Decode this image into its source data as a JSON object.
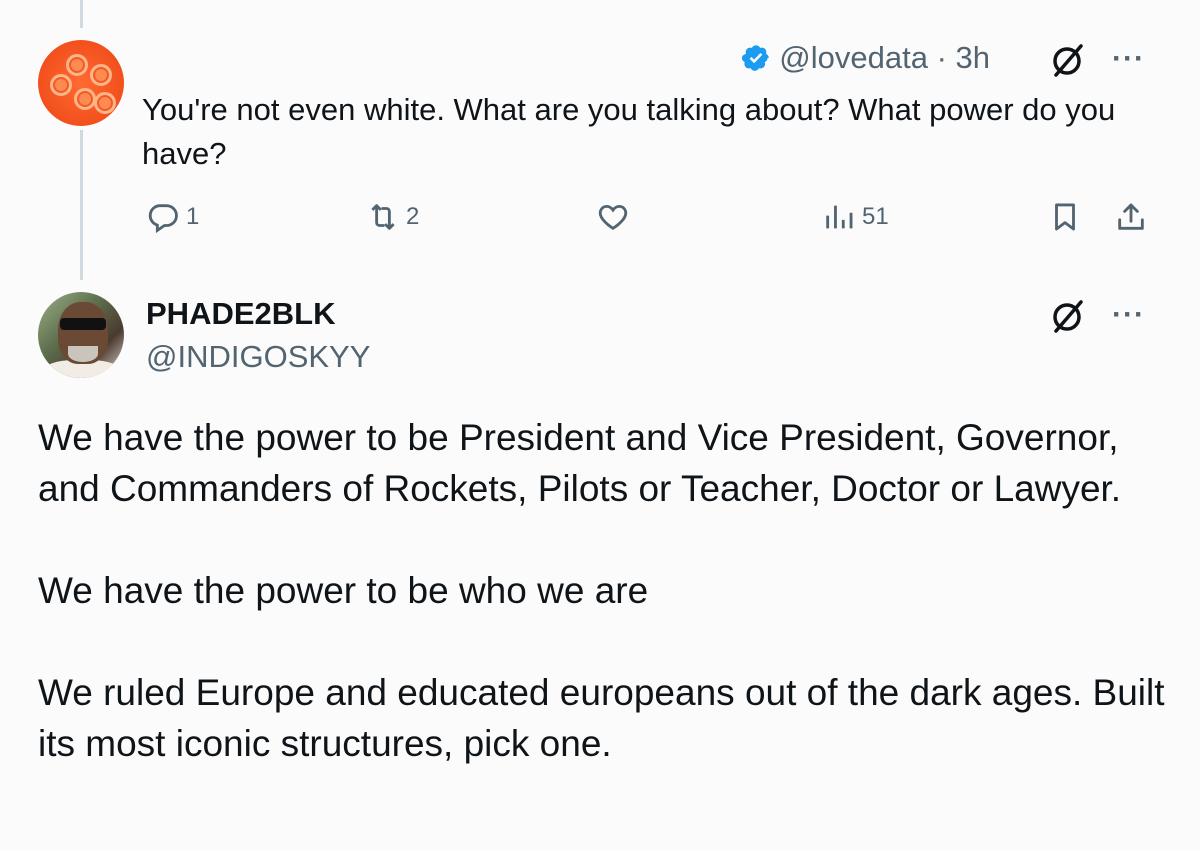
{
  "reply": {
    "handle": "@lovedata · 3h",
    "text": "You're not even white. What are you talking about? What power do you have?",
    "actions": {
      "replies": "1",
      "reposts": "2",
      "views": "51"
    }
  },
  "tweet": {
    "name": "PHADE2BLK",
    "handle": "@INDIGOSKYY",
    "paragraphs": [
      "We have the power to be President and Vice President, Governor, and Commanders of Rockets, Pilots or Teacher, Doctor or Lawyer.",
      "We have the power to be who we are",
      "We ruled Europe and educated europeans out of the dark ages. Built its most iconic structures, pick one."
    ]
  },
  "colors": {
    "verified": "#1d9bf0",
    "muted": "#536471",
    "text": "#0f1419",
    "thread_line": "#cfd9de"
  },
  "icons": [
    "verified-badge-icon",
    "grok-slash-icon",
    "more-icon",
    "reply-icon",
    "repost-icon",
    "like-icon",
    "views-icon",
    "bookmark-icon",
    "share-icon"
  ]
}
